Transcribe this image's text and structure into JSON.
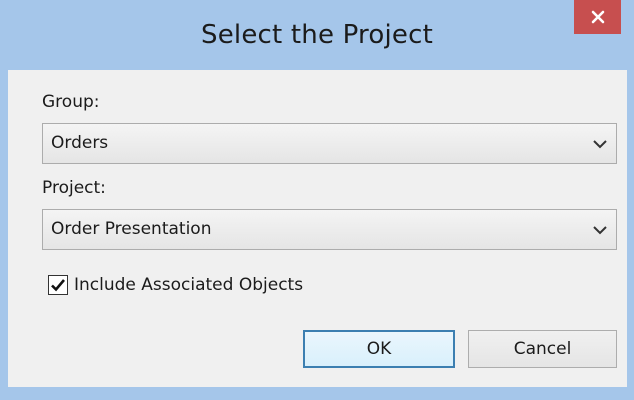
{
  "window": {
    "title": "Select the Project"
  },
  "form": {
    "group_label": "Group:",
    "group_value": "Orders",
    "project_label": "Project:",
    "project_value": "Order Presentation",
    "include_label": "Include Associated Objects",
    "include_checked": true
  },
  "buttons": {
    "ok_label": "OK",
    "cancel_label": "Cancel"
  },
  "icons": {
    "close": "close-icon",
    "dropdown": "chevron-down-icon",
    "check": "checkmark-icon"
  },
  "colors": {
    "frame": "#a5c6ea",
    "close_button": "#c74f4f",
    "content_bg": "#f0f0f0",
    "default_button_border": "#3c7fb1"
  }
}
